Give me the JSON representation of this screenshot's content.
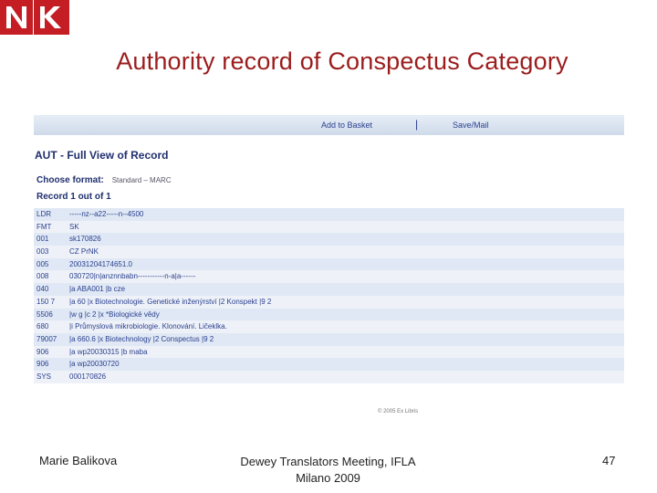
{
  "slide": {
    "title": "Authority record of Conspectus Category",
    "logo_text": "NK",
    "footer_author": "Marie Balikova",
    "footer_event_line1": "Dewey Translators Meeting, IFLA",
    "footer_event_line2": "Milano 2009",
    "page_number": "47"
  },
  "record_view": {
    "add_to_basket": "Add to Basket",
    "separator": "|",
    "save_mail": "Save/Mail",
    "heading": "AUT - Full View of Record",
    "choose_format_label": "Choose format:",
    "format_options": "Standard  –  MARC",
    "record_count": "Record 1 out of 1",
    "copyright": "© 2005 Ex Libris",
    "rows": [
      {
        "tag": "LDR",
        "value": "-----nz--a22-----n--4500"
      },
      {
        "tag": "FMT",
        "value": "SK"
      },
      {
        "tag": "001",
        "value": "sk170826"
      },
      {
        "tag": "003",
        "value": "CZ PrNK"
      },
      {
        "tag": "005",
        "value": "20031204174651.0"
      },
      {
        "tag": "008",
        "value": "030720|n|anznnbabn-----------n-a|a------"
      },
      {
        "tag": "040",
        "value": "|a ABA001 |b cze"
      },
      {
        "tag": "150 7",
        "value": "|a 60 |x Biotechnologie. Genetické inženýrství |2 Konspekt |9 2"
      },
      {
        "tag": "5506",
        "value": "|w g |c 2 |x *Biologické vědy"
      },
      {
        "tag": "680",
        "value": "|i Průmyslová mikrobiologie. Klonování. Ličeklka."
      },
      {
        "tag": "79007",
        "value": "|a 660.6 |x Biotechnology |2 Conspectus |9 2"
      },
      {
        "tag": "906",
        "value": "|a wp20030315 |b maba"
      },
      {
        "tag": "906",
        "value": "|a wp20030720"
      },
      {
        "tag": "SYS",
        "value": "000170826"
      }
    ]
  },
  "colors": {
    "title_red": "#9b1c1c",
    "logo_red": "#c41e24",
    "link_blue": "#2a3f8f"
  }
}
